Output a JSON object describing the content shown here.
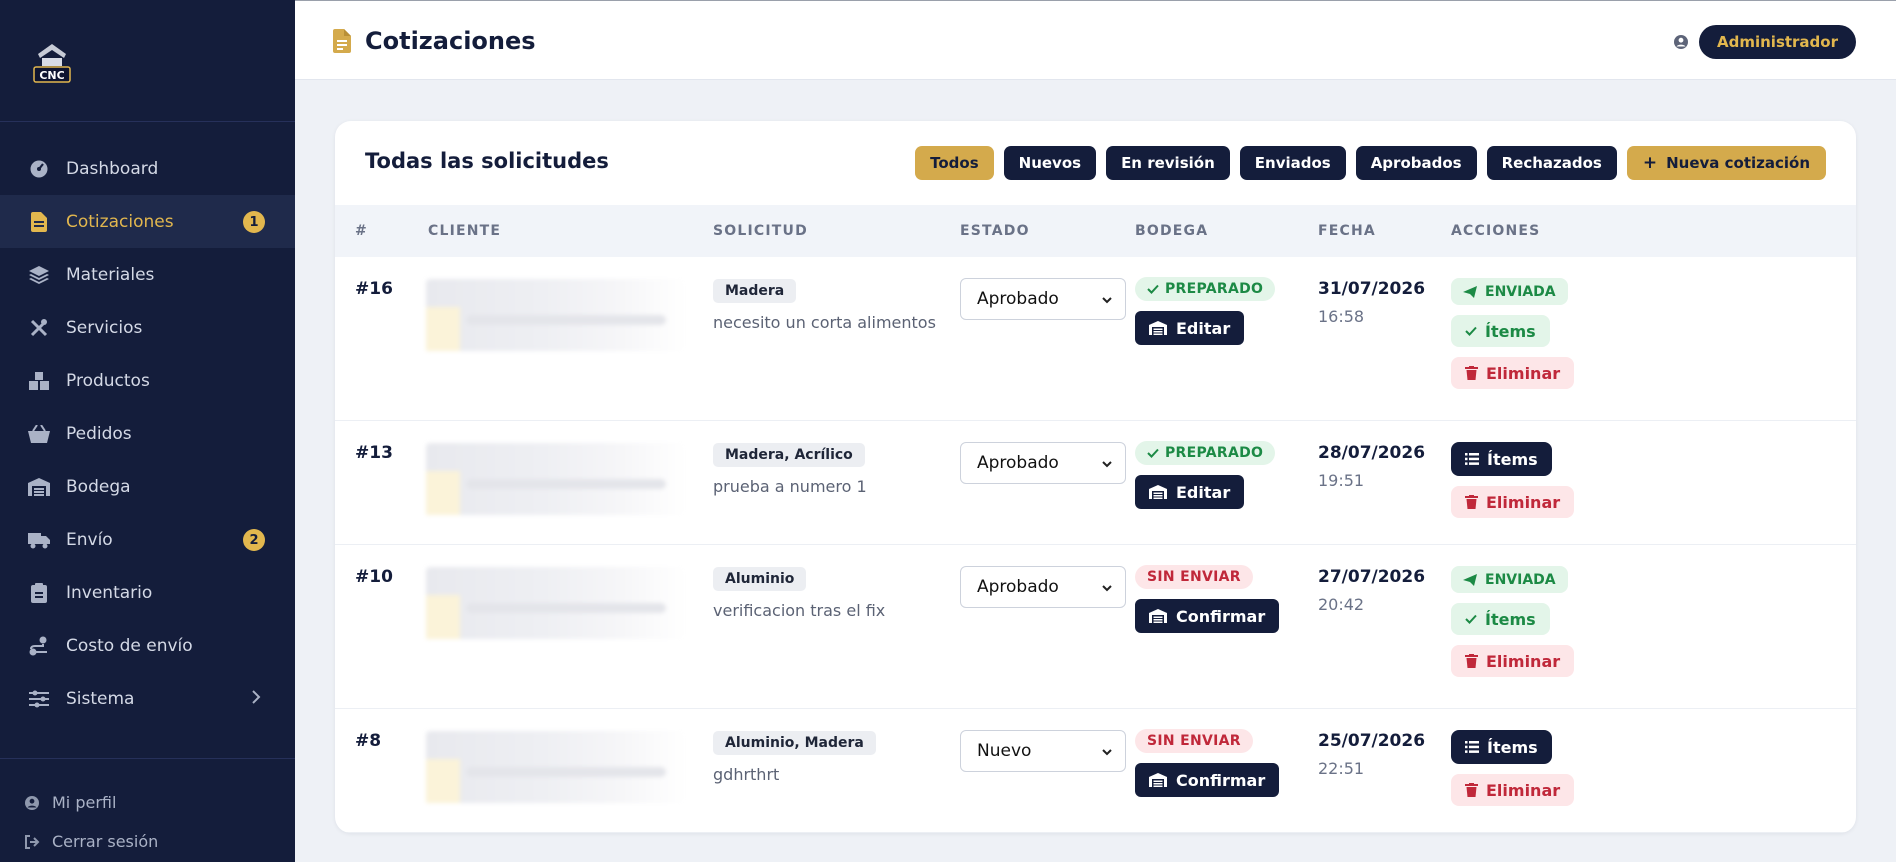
{
  "sidebar": {
    "items": [
      {
        "label": "Dashboard",
        "icon": "gauge-icon",
        "name": "sidebar-item-dashboard"
      },
      {
        "label": "Cotizaciones",
        "icon": "file-invoice-icon",
        "name": "sidebar-item-cotizaciones",
        "badge": "1",
        "active": true
      },
      {
        "label": "Materiales",
        "icon": "layers-icon",
        "name": "sidebar-item-materiales"
      },
      {
        "label": "Servicios",
        "icon": "tools-icon",
        "name": "sidebar-item-servicios"
      },
      {
        "label": "Productos",
        "icon": "boxes-icon",
        "name": "sidebar-item-productos"
      },
      {
        "label": "Pedidos",
        "icon": "basket-icon",
        "name": "sidebar-item-pedidos"
      },
      {
        "label": "Bodega",
        "icon": "warehouse-icon",
        "name": "sidebar-item-bodega"
      },
      {
        "label": "Envío",
        "icon": "truck-icon",
        "name": "sidebar-item-envio",
        "badge": "2"
      },
      {
        "label": "Inventario",
        "icon": "clipboard-icon",
        "name": "sidebar-item-inventario"
      },
      {
        "label": "Costo de envío",
        "icon": "route-icon",
        "name": "sidebar-item-costo-envio"
      },
      {
        "label": "Sistema",
        "icon": "sliders-icon",
        "name": "sidebar-item-sistema",
        "expandable": true
      }
    ],
    "footer": {
      "profile_label": "Mi perfil",
      "logout_label": "Cerrar sesión"
    }
  },
  "header": {
    "title": "Cotizaciones",
    "user_label": "Administrador"
  },
  "card": {
    "title": "Todas las solicitudes",
    "filters": [
      "Todos",
      "Nuevos",
      "En revisión",
      "Enviados",
      "Aprobados",
      "Rechazados"
    ],
    "active_filter": "Todos",
    "new_button": "Nueva cotización"
  },
  "table": {
    "columns": [
      "#",
      "CLIENTE",
      "SOLICITUD",
      "ESTADO",
      "BODEGA",
      "FECHA",
      "ACCIONES"
    ],
    "rows": [
      {
        "id": "#16",
        "tags": "Madera",
        "desc": "necesito un corta alimentos",
        "estado": "Aprobado",
        "bodega_status": "PREPARADO",
        "bodega_ok": true,
        "bodega_btn": "Editar",
        "date": "31/07/2026",
        "time": "16:58",
        "sent": "ENVIADA",
        "items_label": "Ítems",
        "items_done": true,
        "delete_label": "Eliminar"
      },
      {
        "id": "#13",
        "tags": "Madera, Acrílico",
        "desc": "prueba a numero 1",
        "estado": "Aprobado",
        "bodega_status": "PREPARADO",
        "bodega_ok": true,
        "bodega_btn": "Editar",
        "date": "28/07/2026",
        "time": "19:51",
        "sent": null,
        "items_label": "Ítems",
        "items_done": false,
        "delete_label": "Eliminar"
      },
      {
        "id": "#10",
        "tags": "Aluminio",
        "desc": "verificacion tras el fix",
        "estado": "Aprobado",
        "bodega_status": "SIN ENVIAR",
        "bodega_ok": false,
        "bodega_btn": "Confirmar",
        "date": "27/07/2026",
        "time": "20:42",
        "sent": "ENVIADA",
        "items_label": "Ítems",
        "items_done": true,
        "delete_label": "Eliminar"
      },
      {
        "id": "#8",
        "tags": "Aluminio, Madera",
        "desc": "gdhrthrt",
        "estado": "Nuevo",
        "bodega_status": "SIN ENVIAR",
        "bodega_ok": false,
        "bodega_btn": "Confirmar",
        "date": "25/07/2026",
        "time": "22:51",
        "sent": null,
        "items_label": "Ítems",
        "items_done": false,
        "delete_label": "Eliminar"
      }
    ]
  },
  "colors": {
    "sidebar_bg": "#141d3b",
    "accent_gold": "#d4aa4c",
    "success": "#1c8a45",
    "danger": "#c0283a"
  }
}
